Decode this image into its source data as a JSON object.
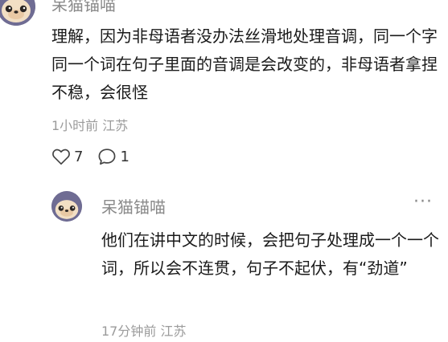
{
  "comment": {
    "author": "呆猫锚喵",
    "more": "···",
    "body": "理解，因为非母语者没办法丝滑地处理音调，同一个字同一个词在句子里面的音调是会改变的，非母语者拿捏不稳，会很怪",
    "time": "1小时前",
    "location": "江苏",
    "likes": "7",
    "replies": "1"
  },
  "reply": {
    "author": "呆猫锚喵",
    "more": "···",
    "body": "他们在讲中文的时候，会把句子处理成一个一个词，所以会不连贯，句子不起伏，有“劲道”",
    "time": "17分钟前",
    "location": "江苏"
  },
  "colors": {
    "avatar_bg": "#6f6c93",
    "seal_face": "#f2dfc4",
    "muted_text": "#9b9b9b",
    "main_text": "#1a1a1a"
  },
  "icons": {
    "like": "heart-outline-icon",
    "reply": "speech-bubble-outline-icon",
    "more": "ellipsis-icon"
  }
}
